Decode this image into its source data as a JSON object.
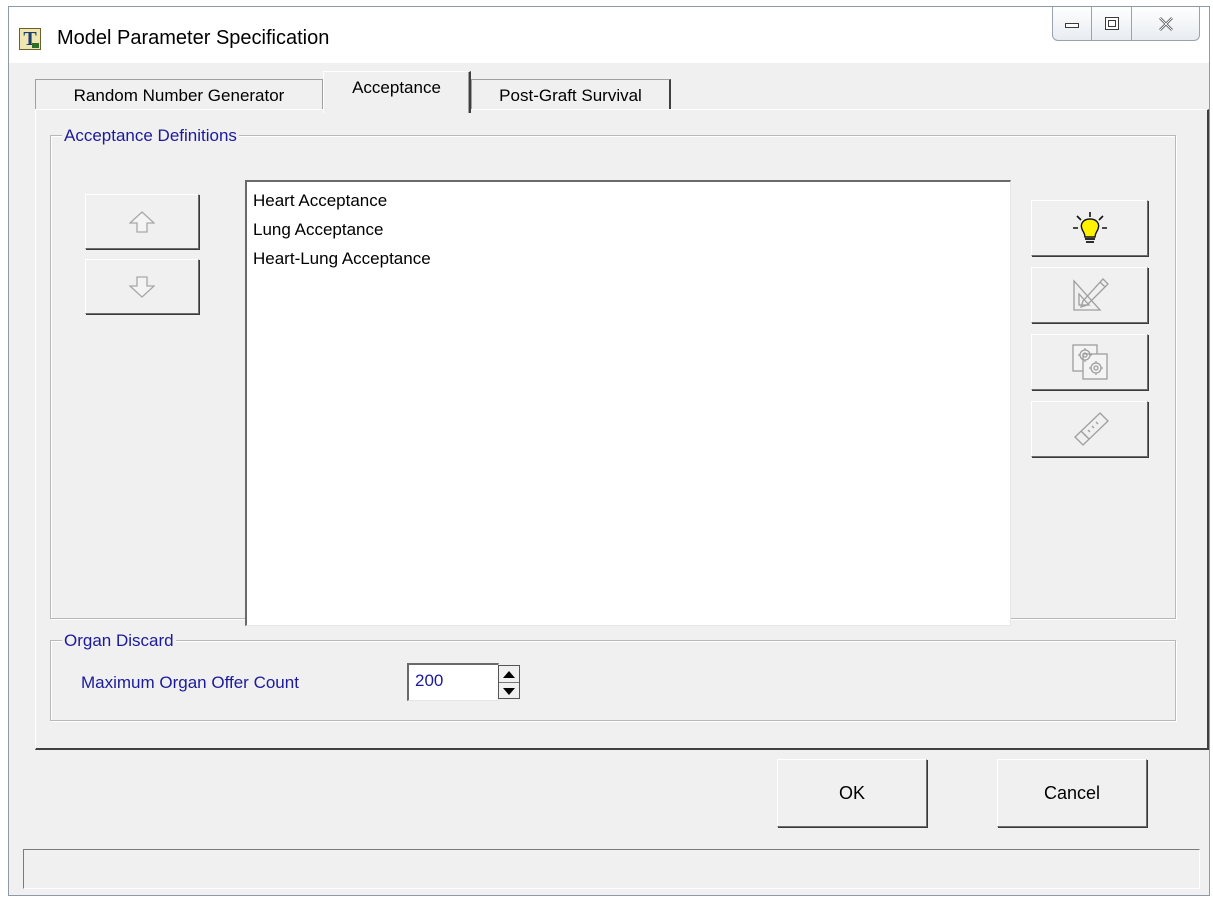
{
  "window": {
    "title": "Model Parameter Specification",
    "app_icon_letter": "T"
  },
  "tabs": [
    {
      "label": "Random Number Generator",
      "active": false
    },
    {
      "label": "Acceptance",
      "active": true
    },
    {
      "label": "Post-Graft Survival",
      "active": false
    }
  ],
  "acceptance_definitions": {
    "legend": "Acceptance Definitions",
    "items": [
      "Heart Acceptance",
      "Lung Acceptance",
      "Heart-Lung Acceptance"
    ],
    "move_up_icon": "arrow-up-icon",
    "move_down_icon": "arrow-down-icon",
    "actions": [
      {
        "name": "new",
        "icon": "lightbulb-icon",
        "enabled": true
      },
      {
        "name": "edit",
        "icon": "pencil-ruler-icon",
        "enabled": false
      },
      {
        "name": "duplicate",
        "icon": "gears-copy-icon",
        "enabled": false
      },
      {
        "name": "delete",
        "icon": "eraser-icon",
        "enabled": false
      }
    ]
  },
  "organ_discard": {
    "legend": "Organ Discard",
    "max_offer_label": "Maximum Organ Offer Count",
    "max_offer_value": "200"
  },
  "buttons": {
    "ok": "OK",
    "cancel": "Cancel"
  },
  "colors": {
    "accent_text": "#1c1a9a",
    "face": "#f0f0f0",
    "bulb": "#fff200"
  }
}
